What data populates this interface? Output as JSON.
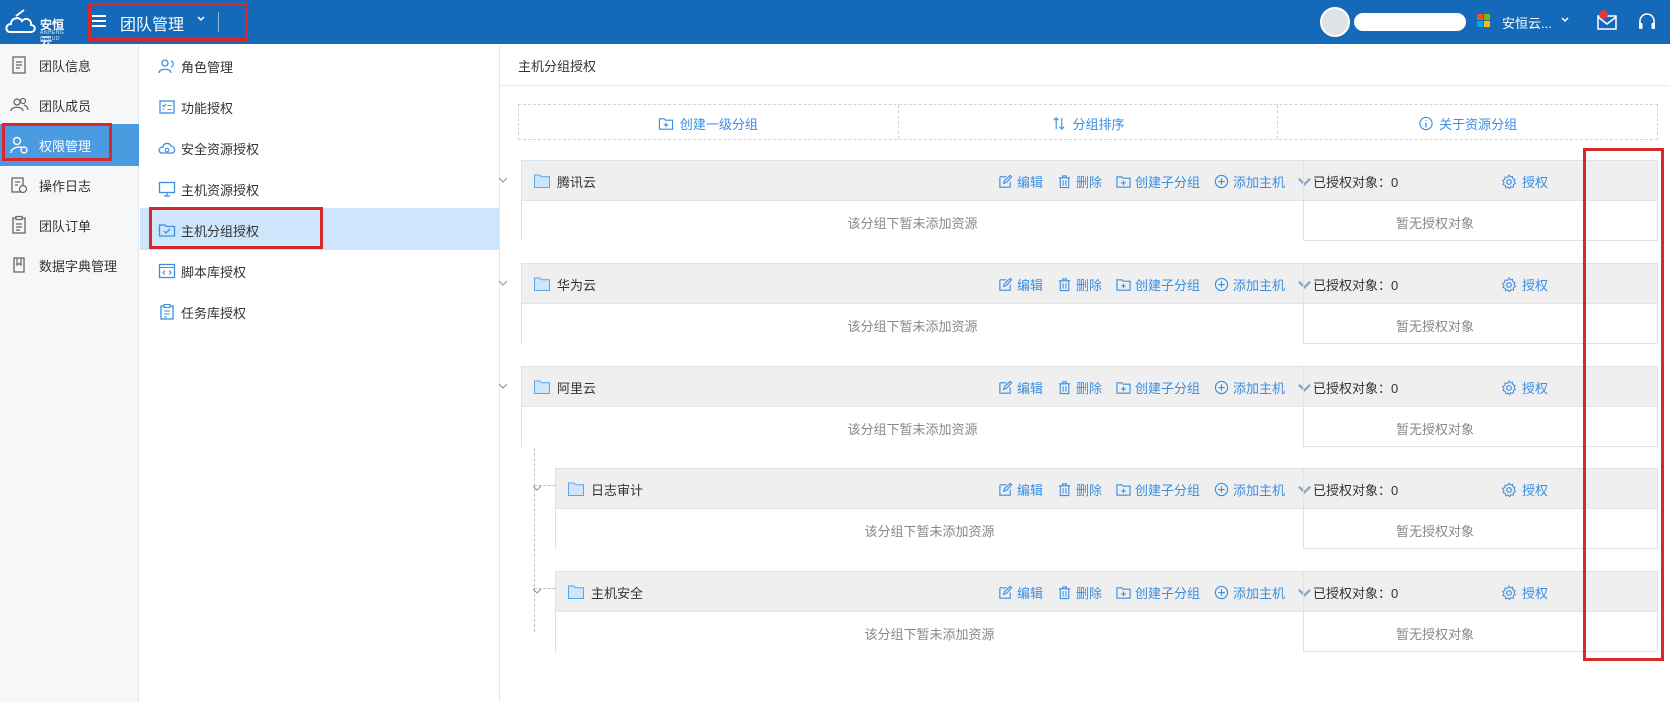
{
  "brand": {
    "logo_text": "安恒云",
    "logo_sub": "ANHENG CLOUD"
  },
  "header": {
    "team_title": "团队管理",
    "org_name": "安恒云..."
  },
  "leftnav": {
    "items": [
      {
        "label": "团队信息",
        "icon": "document-icon"
      },
      {
        "label": "团队成员",
        "icon": "users-icon"
      },
      {
        "label": "权限管理",
        "icon": "user-gear-icon",
        "active": true
      },
      {
        "label": "操作日志",
        "icon": "log-icon"
      },
      {
        "label": "团队订单",
        "icon": "clipboard-icon"
      },
      {
        "label": "数据字典管理",
        "icon": "book-icon"
      }
    ]
  },
  "subnav": {
    "items": [
      {
        "label": "角色管理",
        "icon": "role-icon"
      },
      {
        "label": "功能授权",
        "icon": "checklist-icon"
      },
      {
        "label": "安全资源授权",
        "icon": "cloud-shield-icon"
      },
      {
        "label": "主机资源授权",
        "icon": "monitor-icon"
      },
      {
        "label": "主机分组授权",
        "icon": "folder-check-icon",
        "active": true
      },
      {
        "label": "脚本库授权",
        "icon": "code-icon"
      },
      {
        "label": "任务库授权",
        "icon": "task-icon"
      }
    ]
  },
  "main": {
    "breadcrumb": "主机分组授权",
    "toolbar": {
      "create_group": "创建一级分组",
      "sort_groups": "分组排序",
      "about_groups": "关于资源分组"
    },
    "actions": {
      "edit": "编辑",
      "delete": "删除",
      "create_subgroup": "创建子分组",
      "add_host": "添加主机",
      "grant": "授权"
    },
    "groups": [
      {
        "name": "腾讯云",
        "authorized": "已授权对象：0",
        "empty_text": "该分组下暂未添加资源",
        "no_auth_text": "暂无授权对象",
        "level": 0
      },
      {
        "name": "华为云",
        "authorized": "已授权对象：0",
        "empty_text": "该分组下暂未添加资源",
        "no_auth_text": "暂无授权对象",
        "level": 0
      },
      {
        "name": "阿里云",
        "authorized": "已授权对象：0",
        "empty_text": "该分组下暂未添加资源",
        "no_auth_text": "暂无授权对象",
        "level": 0
      },
      {
        "name": "日志审计",
        "authorized": "已授权对象：0",
        "empty_text": "该分组下暂未添加资源",
        "no_auth_text": "暂无授权对象",
        "level": 1
      },
      {
        "name": "主机安全",
        "authorized": "已授权对象：0",
        "empty_text": "该分组下暂未添加资源",
        "no_auth_text": "暂无授权对象",
        "level": 1
      }
    ]
  },
  "colors": {
    "header_bg": "#1469b9",
    "accent": "#3b8ee0",
    "active_nav": "#4b9be0",
    "highlight": "#d9272e"
  }
}
